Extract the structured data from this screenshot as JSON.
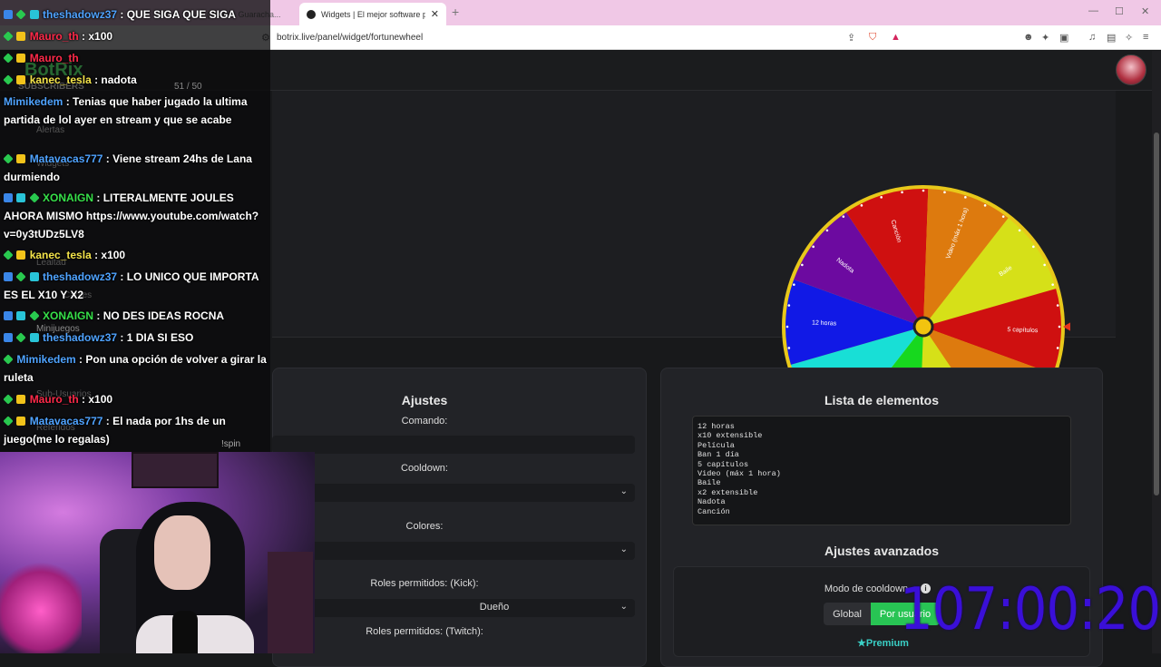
{
  "browser": {
    "tab_prev": "(Ruleta) Guaracha...",
    "tab_active": "Widgets | El mejor software para...",
    "url": "botrix.live/panel/widget/fortunewheel"
  },
  "sidebar": {
    "logo": "BotRix",
    "subscribers": "SUBSCRIBERS",
    "counter": "51 / 50",
    "items": [
      "Alertas",
      "Widgets",
      "Lealtad",
      "Canjes",
      "Minijuegos",
      "Sub-Usuarios",
      "Referidos"
    ]
  },
  "wheel": {
    "segments": [
      {
        "label": "Baile",
        "color": "#d6e018"
      },
      {
        "label": "5 capítulos",
        "color": "#cf1010"
      },
      {
        "label": "Ban 1 día",
        "color": "#dd7a0e"
      },
      {
        "label": "x2 extensible",
        "color": "#d6e018"
      },
      {
        "label": "Película",
        "color": "#17d81e"
      },
      {
        "label": "x10 extensible",
        "color": "#18dfd6"
      },
      {
        "label": "12 horas",
        "color": "#1119e6"
      },
      {
        "label": "Nadota",
        "color": "#6c0aa0"
      },
      {
        "label": "Canción",
        "color": "#cf1010"
      },
      {
        "label": "Video (máx 1 hora)",
        "color": "#dd7a0e"
      }
    ]
  },
  "ajustes": {
    "title": "Ajustes",
    "comando_label": "Comando:",
    "comando_value": "!spin",
    "cooldown_label": "Cooldown:",
    "colores_label": "Colores:",
    "kick_label": "Roles permitidos: (Kick):",
    "kick_value": "Dueño",
    "twitch_label": "Roles permitidos: (Twitch):"
  },
  "lista": {
    "title": "Lista de elementos",
    "items": "12 horas\nx10 extensible\nPelícula\nBan 1 día\n5 capítulos\nVideo (máx 1 hora)\nBaile\nx2 extensible\nNadota\nCanción"
  },
  "avanzados": {
    "title": "Ajustes avanzados",
    "modo_label": "Modo de cooldown",
    "global": "Global",
    "por_usuario": "Por usuario",
    "premium": "Premium"
  },
  "timer": "107:00:20",
  "chat": [
    {
      "badges": [
        "blue",
        "green",
        "cyan"
      ],
      "user": "theshadowz37",
      "color": "#4fa3ff",
      "text": ": QUE SIGA QUE SIGA"
    },
    {
      "badges": [
        "green",
        "yellow"
      ],
      "user": "Mauro_th",
      "color": "#ff2a4a",
      "text": ": x100"
    },
    {
      "badges": [
        "green",
        "yellow"
      ],
      "user": "Mauro_th",
      "color": "#ff2a4a",
      "text": ""
    },
    {
      "badges": [
        "green",
        "yellow"
      ],
      "user": "kanec_tesla",
      "color": "#f4e44a",
      "text": ": nadota"
    },
    {
      "badges": [],
      "user": "Mimikedem",
      "color": "#4fa3ff",
      "text": ": Tenias que haber jugado la ultima partida de lol ayer en stream y que se acabe"
    },
    {
      "badges": [
        "green",
        "yellow"
      ],
      "user": "Matavacas777",
      "color": "#4fa3ff",
      "text": ": Viene stream 24hs de Lana durmiendo"
    },
    {
      "badges": [
        "blue",
        "cyan",
        "green"
      ],
      "user": "XONAIGN",
      "color": "#37e04a",
      "text": ": LITERALMENTE JOULES AHORA MISMO https://www.youtube.com/watch?v=0y3tUDz5LV8"
    },
    {
      "badges": [
        "green",
        "yellow"
      ],
      "user": "kanec_tesla",
      "color": "#f4e44a",
      "text": ": x100"
    },
    {
      "badges": [
        "blue",
        "green",
        "cyan"
      ],
      "user": "theshadowz37",
      "color": "#4fa3ff",
      "text": ": LO UNICO QUE IMPORTA ES EL X10 Y X2"
    },
    {
      "badges": [
        "blue",
        "cyan",
        "green"
      ],
      "user": "XONAIGN",
      "color": "#37e04a",
      "text": ": NO DES IDEAS ROCNA"
    },
    {
      "badges": [
        "blue",
        "green",
        "cyan"
      ],
      "user": "theshadowz37",
      "color": "#4fa3ff",
      "text": ": 1 DIA SI ESO"
    },
    {
      "badges": [
        "green"
      ],
      "user": "Mimikedem",
      "color": "#4fa3ff",
      "text": ": Pon una opción de volver a girar la ruleta"
    },
    {
      "badges": [
        "green",
        "yellow"
      ],
      "user": "Mauro_th",
      "color": "#ff2a4a",
      "text": ": x100"
    },
    {
      "badges": [
        "green",
        "yellow"
      ],
      "user": "Matavacas777",
      "color": "#4fa3ff",
      "text": ": El nada por 1hs de un juego(me lo regalas)"
    }
  ]
}
